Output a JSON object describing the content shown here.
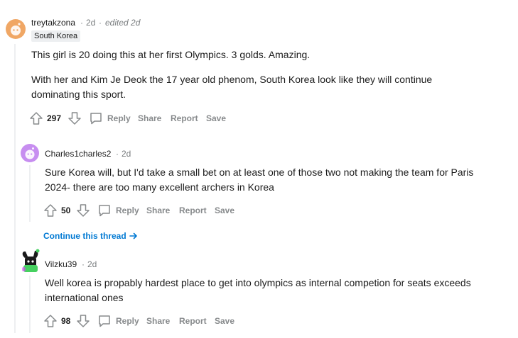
{
  "comments": [
    {
      "username": "treytakzona",
      "sep1": "·",
      "time": "2d",
      "sep2": "·",
      "edited": "edited 2d",
      "flair": "South Korea",
      "paragraphs": [
        "This girl is 20 doing this at her first Olympics. 3 golds. Amazing.",
        "With her and Kim Je Deok the 17 year old phenom, South Korea look like they will continue",
        "dominating this sport."
      ],
      "score": "297",
      "actions": {
        "reply": "Reply",
        "share": "Share",
        "report": "Report",
        "save": "Save"
      }
    },
    {
      "username": "Charles1charles2",
      "sep1": "·",
      "time": "2d",
      "paragraphs": [
        "Sure Korea will, but I'd take a small bet on at least one of those two not making the team for Paris",
        "2024- there are too many excellent archers in Korea"
      ],
      "score": "50",
      "actions": {
        "reply": "Reply",
        "share": "Share",
        "report": "Report",
        "save": "Save"
      },
      "continue": "Continue this thread"
    },
    {
      "username": "Vilzku39",
      "sep1": "·",
      "time": "2d",
      "paragraphs": [
        "Well korea is propably hardest place to get into olympics as internal competion for seats exceeds",
        "international ones"
      ],
      "score": "98",
      "actions": {
        "reply": "Reply",
        "share": "Share",
        "report": "Report",
        "save": "Save"
      }
    }
  ],
  "colors": {
    "action_gray": "#878a8c",
    "link_blue": "#0079d3",
    "avatar1": "#f0a765",
    "avatar2": "#c78ef0",
    "avatar3": "#1a1a1b",
    "thread_line": "#edeff1"
  },
  "icons": [
    "upvote-icon",
    "downvote-icon",
    "comment-icon",
    "arrow-right-icon"
  ]
}
